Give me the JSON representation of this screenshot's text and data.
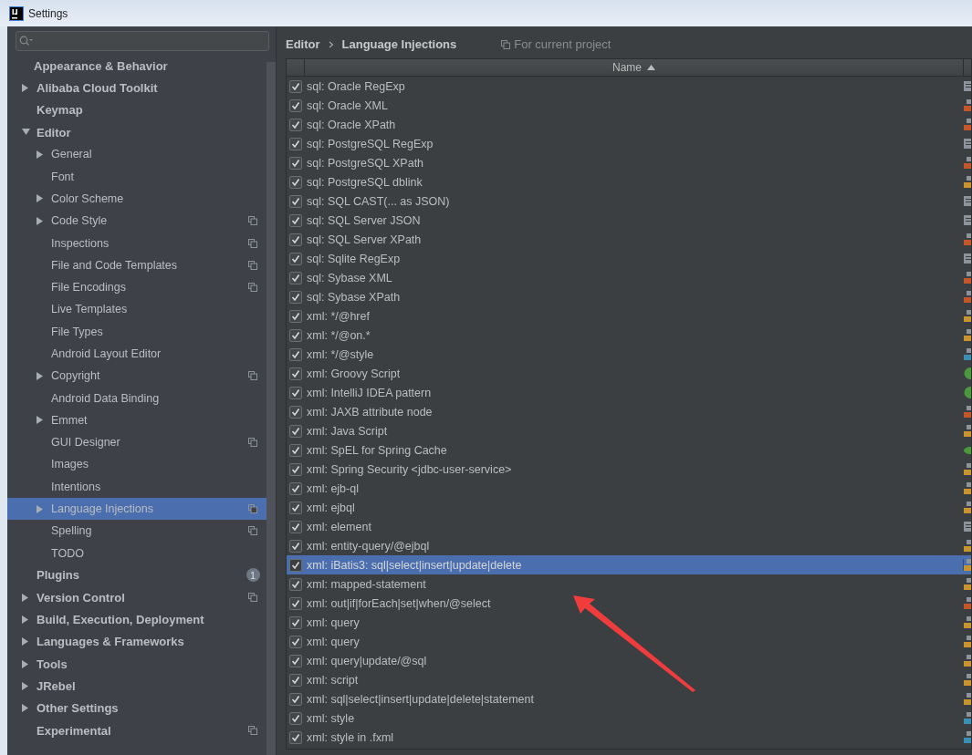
{
  "window": {
    "title": "Settings"
  },
  "sidebar": {
    "items": [
      {
        "label": "Appearance & Behavior",
        "kind": "header"
      },
      {
        "label": "Alibaba Cloud Toolkit",
        "kind": "branch",
        "expanded": false
      },
      {
        "label": "Keymap",
        "kind": "leaf"
      },
      {
        "label": "Editor",
        "kind": "branch",
        "expanded": true,
        "children": [
          {
            "label": "General",
            "kind": "branch",
            "expanded": false
          },
          {
            "label": "Font",
            "kind": "leaf"
          },
          {
            "label": "Color Scheme",
            "kind": "branch",
            "expanded": false
          },
          {
            "label": "Code Style",
            "kind": "branch",
            "expanded": false,
            "project": true
          },
          {
            "label": "Inspections",
            "kind": "leaf",
            "project": true
          },
          {
            "label": "File and Code Templates",
            "kind": "leaf",
            "project": true
          },
          {
            "label": "File Encodings",
            "kind": "leaf",
            "project": true
          },
          {
            "label": "Live Templates",
            "kind": "leaf"
          },
          {
            "label": "File Types",
            "kind": "leaf"
          },
          {
            "label": "Android Layout Editor",
            "kind": "leaf"
          },
          {
            "label": "Copyright",
            "kind": "branch",
            "expanded": false,
            "project": true
          },
          {
            "label": "Android Data Binding",
            "kind": "leaf"
          },
          {
            "label": "Emmet",
            "kind": "branch",
            "expanded": false
          },
          {
            "label": "GUI Designer",
            "kind": "leaf",
            "project": true
          },
          {
            "label": "Images",
            "kind": "leaf"
          },
          {
            "label": "Intentions",
            "kind": "leaf"
          },
          {
            "label": "Language Injections",
            "kind": "branch",
            "expanded": false,
            "project": true,
            "selected": true
          },
          {
            "label": "Spelling",
            "kind": "leaf",
            "project": true
          },
          {
            "label": "TODO",
            "kind": "leaf"
          }
        ]
      },
      {
        "label": "Plugins",
        "kind": "leaf",
        "badge": "1"
      },
      {
        "label": "Version Control",
        "kind": "branch",
        "expanded": false,
        "project": true
      },
      {
        "label": "Build, Execution, Deployment",
        "kind": "branch",
        "expanded": false
      },
      {
        "label": "Languages & Frameworks",
        "kind": "branch",
        "expanded": false
      },
      {
        "label": "Tools",
        "kind": "branch",
        "expanded": false
      },
      {
        "label": "JRebel",
        "kind": "branch",
        "expanded": false
      },
      {
        "label": "Other Settings",
        "kind": "branch",
        "expanded": false
      },
      {
        "label": "Experimental",
        "kind": "leaf",
        "project": true
      }
    ]
  },
  "breadcrumb": [
    "Editor",
    "Language Injections"
  ],
  "scope": "For current project",
  "table": {
    "columns": [
      "Name"
    ],
    "rows": [
      {
        "name": "sql: Oracle RegExp",
        "checked": true,
        "selected": false,
        "kind": "file",
        "color": "#8c939b"
      },
      {
        "name": "sql: Oracle XML",
        "checked": true,
        "selected": false,
        "kind": "badge",
        "color": "#c5562a"
      },
      {
        "name": "sql: Oracle XPath",
        "checked": true,
        "selected": false,
        "kind": "badge",
        "color": "#c5562a"
      },
      {
        "name": "sql: PostgreSQL RegExp",
        "checked": true,
        "selected": false,
        "kind": "file",
        "color": "#8c939b"
      },
      {
        "name": "sql: PostgreSQL XPath",
        "checked": true,
        "selected": false,
        "kind": "badge",
        "color": "#c5562a"
      },
      {
        "name": "sql: PostgreSQL dblink",
        "checked": true,
        "selected": false,
        "kind": "badge",
        "color": "#c8952c"
      },
      {
        "name": "sql: SQL CAST(... as JSON)",
        "checked": true,
        "selected": false,
        "kind": "file",
        "color": "#8c939b"
      },
      {
        "name": "sql: SQL Server JSON",
        "checked": true,
        "selected": false,
        "kind": "file",
        "color": "#8c939b"
      },
      {
        "name": "sql: SQL Server XPath",
        "checked": true,
        "selected": false,
        "kind": "badge",
        "color": "#c5562a"
      },
      {
        "name": "sql: Sqlite RegExp",
        "checked": true,
        "selected": false,
        "kind": "file",
        "color": "#8c939b"
      },
      {
        "name": "sql: Sybase XML",
        "checked": true,
        "selected": false,
        "kind": "badge",
        "color": "#c5562a"
      },
      {
        "name": "sql: Sybase XPath",
        "checked": true,
        "selected": false,
        "kind": "badge",
        "color": "#c5562a"
      },
      {
        "name": "xml: */@href",
        "checked": true,
        "selected": false,
        "kind": "badge",
        "color": "#c8952c"
      },
      {
        "name": "xml: */@on.*",
        "checked": true,
        "selected": false,
        "kind": "badge",
        "color": "#c8952c"
      },
      {
        "name": "xml: */@style",
        "checked": true,
        "selected": false,
        "kind": "badge",
        "color": "#3a8fb5"
      },
      {
        "name": "xml: Groovy Script",
        "checked": true,
        "selected": false,
        "kind": "circle",
        "color": "#4a9a3c"
      },
      {
        "name": "xml: IntelliJ IDEA pattern",
        "checked": true,
        "selected": false,
        "kind": "circle",
        "color": "#4a9a3c"
      },
      {
        "name": "xml: JAXB attribute node",
        "checked": true,
        "selected": false,
        "kind": "badge",
        "color": "#c5562a"
      },
      {
        "name": "xml: Java Script",
        "checked": true,
        "selected": false,
        "kind": "badge",
        "color": "#c8952c"
      },
      {
        "name": "xml: SpEL for Spring Cache",
        "checked": true,
        "selected": false,
        "kind": "leaf",
        "color": "#4a9a3c"
      },
      {
        "name": "xml: Spring Security <jdbc-user-service>",
        "checked": true,
        "selected": false,
        "kind": "badge",
        "color": "#c8952c"
      },
      {
        "name": "xml: ejb-ql",
        "checked": true,
        "selected": false,
        "kind": "badge",
        "color": "#c8952c"
      },
      {
        "name": "xml: ejbql",
        "checked": true,
        "selected": false,
        "kind": "badge",
        "color": "#c8952c"
      },
      {
        "name": "xml: element",
        "checked": true,
        "selected": false,
        "kind": "file",
        "color": "#8c939b"
      },
      {
        "name": "xml: entity-query/@ejbql",
        "checked": true,
        "selected": false,
        "kind": "badge",
        "color": "#c8952c"
      },
      {
        "name": "xml: iBatis3: sql|select|insert|update|delete",
        "checked": true,
        "selected": true,
        "kind": "badge",
        "color": "#c8952c"
      },
      {
        "name": "xml: mapped-statement",
        "checked": true,
        "selected": false,
        "kind": "badge",
        "color": "#c8952c"
      },
      {
        "name": "xml: out|if|forEach|set|when/@select",
        "checked": true,
        "selected": false,
        "kind": "badge",
        "color": "#c5562a"
      },
      {
        "name": "xml: query",
        "checked": true,
        "selected": false,
        "kind": "badge",
        "color": "#c8952c"
      },
      {
        "name": "xml: query",
        "checked": true,
        "selected": false,
        "kind": "badge",
        "color": "#c8952c"
      },
      {
        "name": "xml: query|update/@sql",
        "checked": true,
        "selected": false,
        "kind": "badge",
        "color": "#c8952c"
      },
      {
        "name": "xml: script",
        "checked": true,
        "selected": false,
        "kind": "badge",
        "color": "#c8952c"
      },
      {
        "name": "xml: sql|select|insert|update|delete|statement",
        "checked": true,
        "selected": false,
        "kind": "badge",
        "color": "#c8952c"
      },
      {
        "name": "xml: style",
        "checked": true,
        "selected": false,
        "kind": "badge",
        "color": "#3a8fb5"
      },
      {
        "name": "xml: style in .fxml",
        "checked": true,
        "selected": false,
        "kind": "badge",
        "color": "#3a8fb5"
      }
    ]
  }
}
